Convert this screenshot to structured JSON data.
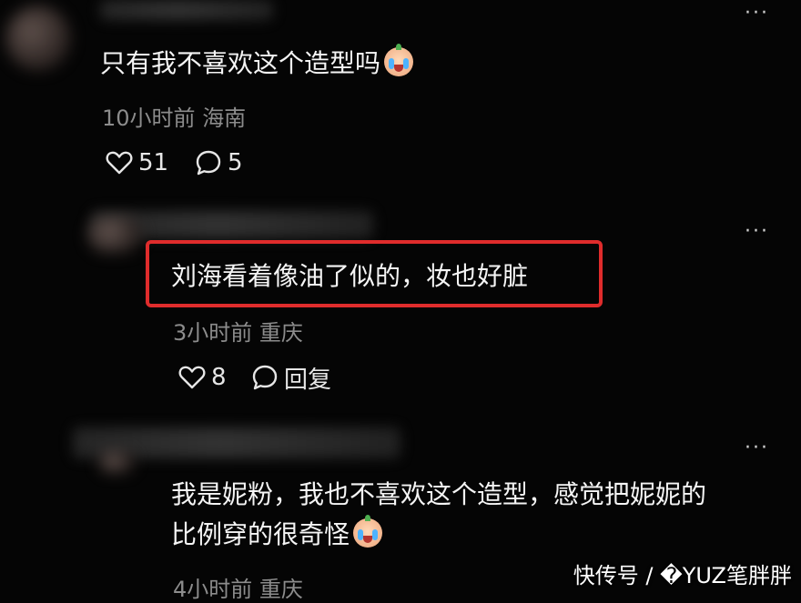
{
  "comments": [
    {
      "text": "只有我不喜欢这个造型吗",
      "emoji": "crying-face-emoji",
      "time": "10小时前",
      "location": "海南",
      "likes": "51",
      "replies": "5"
    },
    {
      "text": "刘海看着像油了似的，妆也好脏",
      "time": "3小时前",
      "location": "重庆",
      "likes": "8",
      "replies": "回复"
    },
    {
      "text_line1": "我是妮粉，我也不喜欢这个造型，感觉把妮妮的",
      "text_line2": "比例穿的很奇怪",
      "emoji": "crying-face-emoji",
      "time": "4小时前",
      "location": "重庆"
    }
  ],
  "more_label": "···",
  "watermark": "快传号 / �YUZ笔胖胖",
  "colors": {
    "background": "#050505",
    "highlight": "#e02c2c",
    "meta": "#8c8c8c"
  }
}
